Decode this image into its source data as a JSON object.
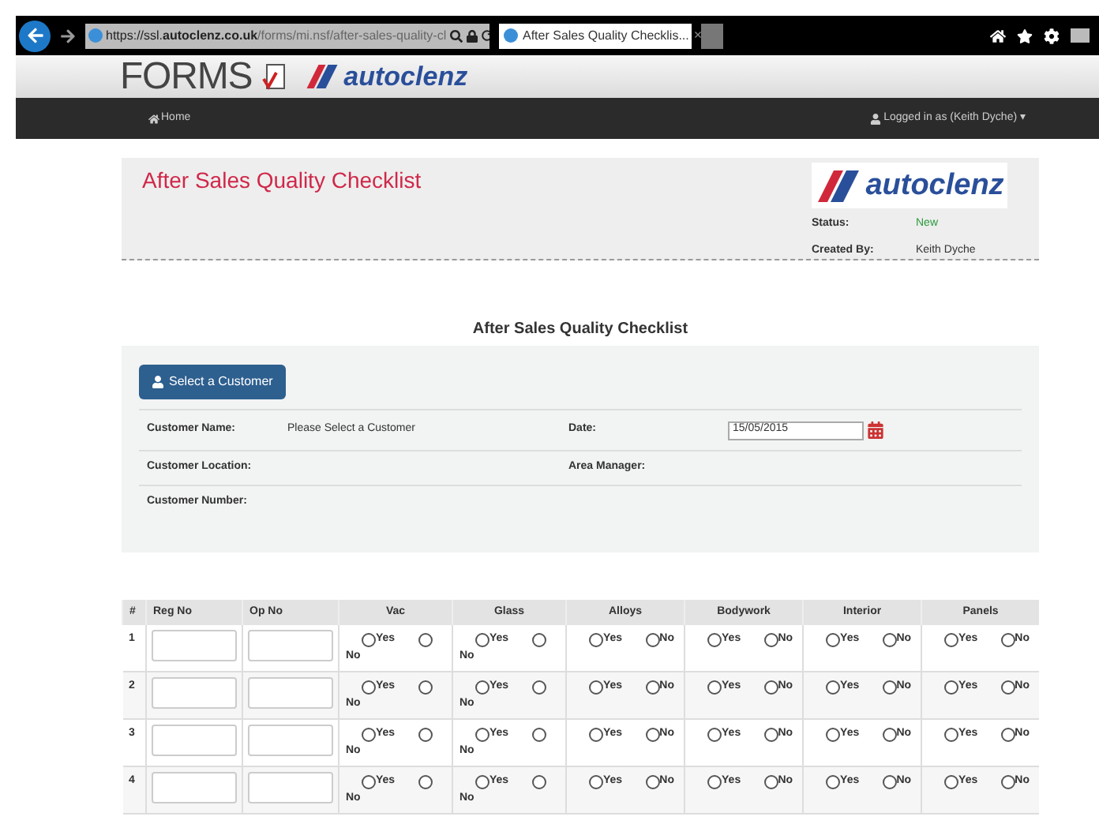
{
  "browser": {
    "url_host_prefix": "https://ssl.",
    "url_host": "autoclenz.co.uk",
    "url_path": "/forms/mi.nsf/after-sales-quality-cl",
    "tab_title": "After Sales Quality Checklis...",
    "tab_close": "×"
  },
  "header": {
    "forms_logo": "FORMS",
    "brand": "autoclenz"
  },
  "nav": {
    "home": "Home",
    "user": "Logged in as (Keith Dyche)",
    "user_caret": "▾"
  },
  "title_panel": {
    "title": "After Sales Quality Checklist",
    "brand": "autoclenz",
    "status_label": "Status:",
    "status_value": "New",
    "created_label": "Created By:",
    "created_value": "Keith Dyche"
  },
  "section_title": "After Sales Quality Checklist",
  "customer": {
    "button": "Select a Customer",
    "name_label": "Customer Name:",
    "name_value": "Please Select a Customer",
    "date_label": "Date:",
    "date_value": "15/05/2015",
    "location_label": "Customer Location:",
    "manager_label": "Area Manager:",
    "number_label": "Customer Number:"
  },
  "table": {
    "columns": [
      {
        "label": "#",
        "kind": "number"
      },
      {
        "label": "Reg No",
        "kind": "input"
      },
      {
        "label": "Op No",
        "kind": "input"
      },
      {
        "label": "Vac",
        "kind": "wrapped"
      },
      {
        "label": "Glass",
        "kind": "wrapped"
      },
      {
        "label": "Alloys",
        "kind": "inline"
      },
      {
        "label": "Bodywork",
        "kind": "inline"
      },
      {
        "label": "Interior",
        "kind": "inline"
      },
      {
        "label": "Panels",
        "kind": "inline"
      }
    ],
    "rows": [
      {
        "number": "1",
        "checks": [
          [
            {
              "label": "Yes",
              "selected": false
            },
            {
              "label": "No",
              "selected": false
            }
          ],
          [
            {
              "label": "Yes",
              "selected": false
            },
            {
              "label": "No",
              "selected": false
            }
          ],
          [
            {
              "label": "Yes",
              "selected": false
            },
            {
              "label": "No",
              "selected": false
            }
          ],
          [
            {
              "label": "Yes",
              "selected": false
            },
            {
              "label": "No",
              "selected": false
            }
          ],
          [
            {
              "label": "Yes",
              "selected": false
            },
            {
              "label": "No",
              "selected": false
            }
          ],
          [
            {
              "label": "Yes",
              "selected": false
            },
            {
              "label": "No",
              "selected": false
            }
          ]
        ]
      },
      {
        "number": "2",
        "checks": [
          [
            {
              "label": "Yes",
              "selected": false
            },
            {
              "label": "No",
              "selected": false
            }
          ],
          [
            {
              "label": "Yes",
              "selected": false
            },
            {
              "label": "No",
              "selected": false
            }
          ],
          [
            {
              "label": "Yes",
              "selected": false
            },
            {
              "label": "No",
              "selected": false
            }
          ],
          [
            {
              "label": "Yes",
              "selected": false
            },
            {
              "label": "No",
              "selected": false
            }
          ],
          [
            {
              "label": "Yes",
              "selected": false
            },
            {
              "label": "No",
              "selected": false
            }
          ],
          [
            {
              "label": "Yes",
              "selected": false
            },
            {
              "label": "No",
              "selected": false
            }
          ]
        ]
      },
      {
        "number": "3",
        "checks": [
          [
            {
              "label": "Yes",
              "selected": false
            },
            {
              "label": "No",
              "selected": false
            }
          ],
          [
            {
              "label": "Yes",
              "selected": false
            },
            {
              "label": "No",
              "selected": false
            }
          ],
          [
            {
              "label": "Yes",
              "selected": false
            },
            {
              "label": "No",
              "selected": false
            }
          ],
          [
            {
              "label": "Yes",
              "selected": false
            },
            {
              "label": "No",
              "selected": false
            }
          ],
          [
            {
              "label": "Yes",
              "selected": false
            },
            {
              "label": "No",
              "selected": false
            }
          ],
          [
            {
              "label": "Yes",
              "selected": false
            },
            {
              "label": "No",
              "selected": false
            }
          ]
        ]
      },
      {
        "number": "4",
        "checks": [
          [
            {
              "label": "Yes",
              "selected": false
            },
            {
              "label": "No",
              "selected": false
            }
          ],
          [
            {
              "label": "Yes",
              "selected": false
            },
            {
              "label": "No",
              "selected": false
            }
          ],
          [
            {
              "label": "Yes",
              "selected": false
            },
            {
              "label": "No",
              "selected": false
            }
          ],
          [
            {
              "label": "Yes",
              "selected": false
            },
            {
              "label": "No",
              "selected": false
            }
          ],
          [
            {
              "label": "Yes",
              "selected": false
            },
            {
              "label": "No",
              "selected": false
            }
          ],
          [
            {
              "label": "Yes",
              "selected": false
            },
            {
              "label": "No",
              "selected": false
            }
          ]
        ]
      }
    ]
  }
}
